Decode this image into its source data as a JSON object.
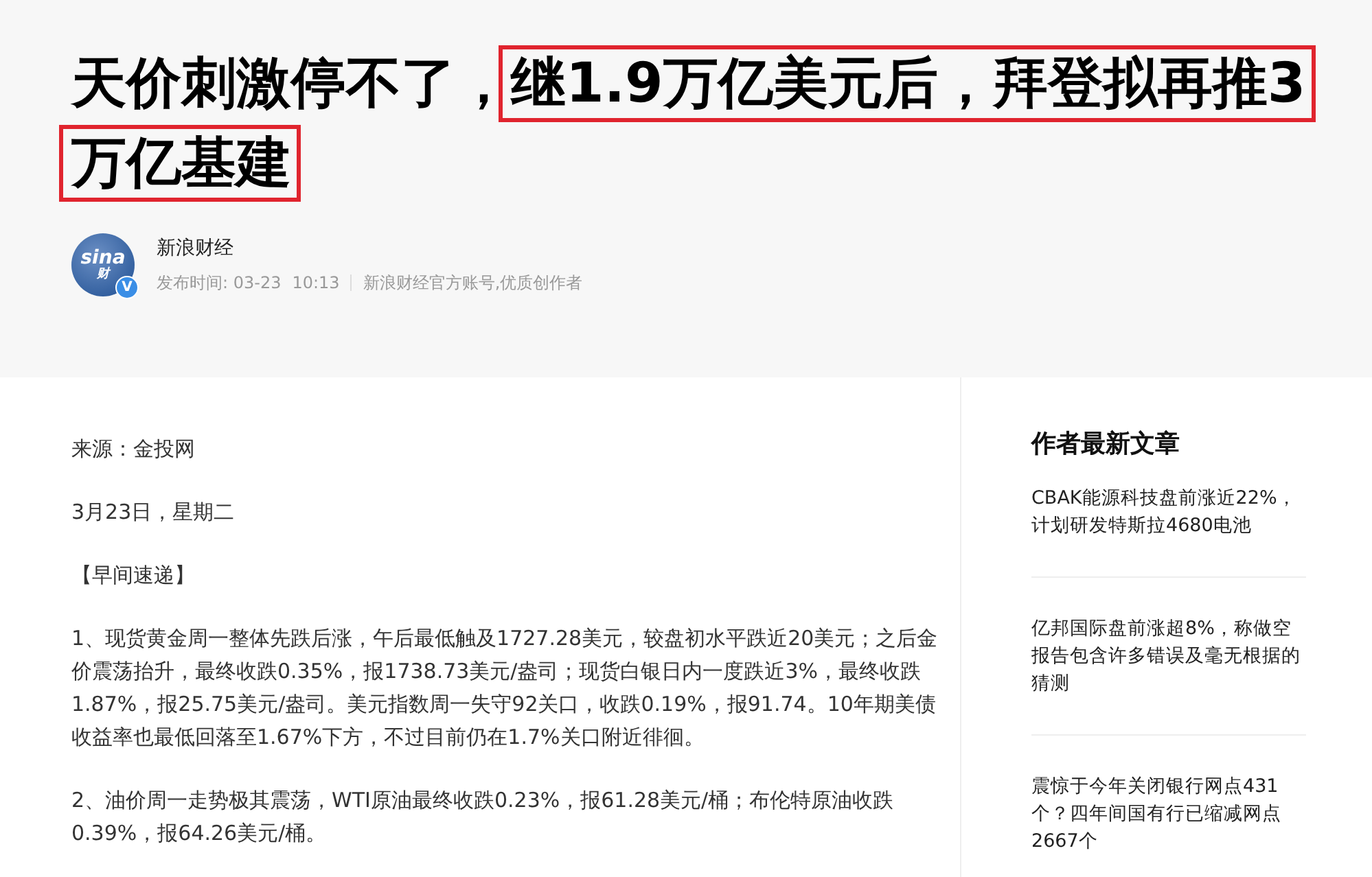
{
  "article": {
    "title_lines": [
      {
        "segments": [
          {
            "text": "天价刺激停不了，",
            "highlighted": false
          },
          {
            "text": "继1.9万亿美元后，拜登拟再推3",
            "highlighted": true
          }
        ]
      },
      {
        "segments": [
          {
            "text": "万亿基建",
            "highlighted": true
          }
        ]
      }
    ],
    "author": {
      "avatar_text": "sina",
      "avatar_subtext": "财",
      "verified": true,
      "badge": "V",
      "name": "新浪财经",
      "published_label": "发布时间: 03-23",
      "time": "10:13",
      "description": "新浪财经官方账号,优质创作者"
    },
    "paragraphs": [
      "来源：金投网",
      "3月23日，星期二",
      "【早间速递】",
      "1、现货黄金周一整体先跌后涨，午后最低触及1727.28美元，较盘初水平跌近20美元；之后金价震荡抬升，最终收跌0.35%，报1738.73美元/盎司；现货白银日内一度跌近3%，最终收跌1.87%，报25.75美元/盎司。美元指数周一失守92关口，收跌0.19%，报91.74。10年期美债收益率也最低回落至1.67%下方，不过目前仍在1.7%关口附近徘徊。",
      "2、油价周一走势极其震荡，WTI原油最终收跌0.23%，报61.28美元/桶；布伦特原油收跌0.39%，报64.26美元/桶。"
    ]
  },
  "sidebar": {
    "title": "作者最新文章",
    "items": [
      "CBAK能源科技盘前涨近22%，计划研发特斯拉4680电池",
      "亿邦国际盘前涨超8%，称做空报告包含许多错误及毫无根据的猜测",
      "震惊于今年关闭银行网点431个？四年间国有行已缩减网点2667个"
    ]
  }
}
